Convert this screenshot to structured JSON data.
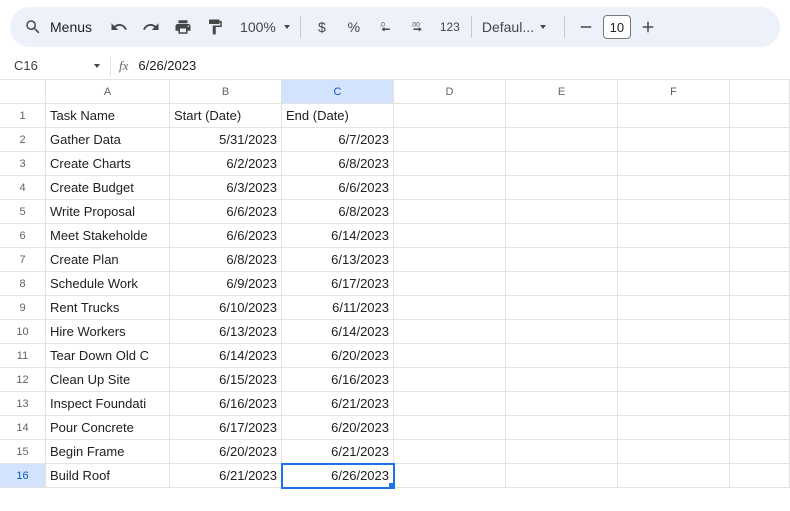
{
  "toolbar": {
    "menus_label": "Menus",
    "zoom": "100%",
    "font": "Defaul...",
    "font_size": "10",
    "dollar": "$",
    "percent": "%",
    "one_two_three": "123"
  },
  "namebox": {
    "cell_ref": "C16",
    "fx_label": "fx",
    "formula": "6/26/2023"
  },
  "columns": [
    "A",
    "B",
    "C",
    "D",
    "E",
    "F",
    ""
  ],
  "selected_col_index": 2,
  "selected_row_index": 16,
  "chart_data": {
    "type": "table",
    "headers": [
      "Task Name",
      "Start (Date)",
      "End (Date)"
    ],
    "rows": [
      [
        "Gather Data",
        "5/31/2023",
        "6/7/2023"
      ],
      [
        "Create Charts",
        "6/2/2023",
        "6/8/2023"
      ],
      [
        "Create Budget",
        "6/3/2023",
        "6/6/2023"
      ],
      [
        "Write Proposal",
        "6/6/2023",
        "6/8/2023"
      ],
      [
        "Meet Stakeholde",
        "6/6/2023",
        "6/14/2023"
      ],
      [
        "Create Plan",
        "6/8/2023",
        "6/13/2023"
      ],
      [
        "Schedule Work",
        "6/9/2023",
        "6/17/2023"
      ],
      [
        "Rent Trucks",
        "6/10/2023",
        "6/11/2023"
      ],
      [
        "Hire Workers",
        "6/13/2023",
        "6/14/2023"
      ],
      [
        "Tear Down Old C",
        "6/14/2023",
        "6/20/2023"
      ],
      [
        "Clean Up Site",
        "6/15/2023",
        "6/16/2023"
      ],
      [
        "Inspect Foundati",
        "6/16/2023",
        "6/21/2023"
      ],
      [
        "Pour Concrete",
        "6/17/2023",
        "6/20/2023"
      ],
      [
        "Begin Frame",
        "6/20/2023",
        "6/21/2023"
      ],
      [
        "Build Roof",
        "6/21/2023",
        "6/26/2023"
      ]
    ]
  }
}
